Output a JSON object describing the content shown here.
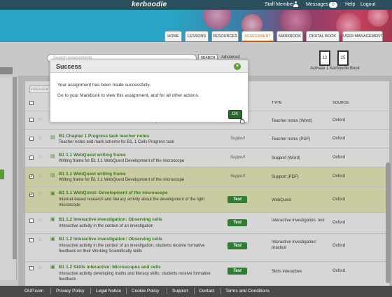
{
  "topbar": {
    "logo": "kerboodle",
    "user": "Staff Member",
    "messages_label": "Messages",
    "messages_count": "0",
    "help": "Help",
    "logout": "Logout"
  },
  "nav": {
    "tabs": [
      "HOME",
      "LESSONS",
      "RESOURCES",
      "ASSESSMENT",
      "MARKBOOK",
      "DIGITAL BOOK",
      "USER MANAGEMENT"
    ],
    "active": "ASSESSMENT"
  },
  "search": {
    "placeholder": "Search assessments",
    "button": "SEARCH",
    "advanced": "Advanced"
  },
  "activation": {
    "count_a": "12",
    "count_b": "25",
    "label": "Activate 1 Kerboodle Book"
  },
  "toolbar": {
    "preview": "PREVIEW"
  },
  "table": {
    "headers": {
      "type": "TYPE",
      "source": "SOURCE"
    },
    "rows": [
      {
        "title": "",
        "desc": "Teacher notes and mark scheme for B1, 1 Cells Progress task",
        "badge": "",
        "type": "Teacher notes (Word)",
        "source": "Oxford",
        "checked": false
      },
      {
        "title": "B1 Chapter 1 Progress task teacher notes",
        "desc": "Teacher notes and mark scheme for B1, 1 Cells Progress task",
        "badge": "Support",
        "type": "Teacher notes (PDF)",
        "source": "Oxford",
        "checked": false
      },
      {
        "title": "B1 1.1 WebQuest writing frame",
        "desc": "Writing frame for B1 1.1 WebQuest Development of the microscope",
        "badge": "Support",
        "type": "Support (Word)",
        "source": "Oxford",
        "checked": false
      },
      {
        "title": "B1 1.1 WebQuest writing frame",
        "desc": "Writing frame for B1 1.1 WebQuest Development of the microscope",
        "badge": "Support",
        "type": "Support (PDF)",
        "source": "Oxford",
        "checked": true
      },
      {
        "title": "B1 1.1 WebQuest: Development of the microscope",
        "desc": "Internet-based research and literacy activity about the development of the light microscope",
        "badge": "Test",
        "type": "WebQuest",
        "source": "Oxford",
        "checked": true
      },
      {
        "title": "B1 1.2 Interactive investigation: Observing cells",
        "desc": "Interactive activity in the context of an investigation",
        "badge": "Test",
        "type": "Interactive investigation: test",
        "source": "Oxford",
        "checked": false
      },
      {
        "title": "B1 1.2 Interactive investigation: Observing cells",
        "desc": "Interactive activity in the context of an investigation; students receive formative feedback on their Working Scientifically skills",
        "badge": "Test",
        "type": "Interactive investigation: practice",
        "source": "Oxford",
        "checked": false
      },
      {
        "title": "B1 1.2 Skills interactive: Microscopes and cells",
        "desc": "Interactive activity developing maths and literacy skills; students receive formative feedback",
        "badge": "Test",
        "type": "Skills interactive",
        "source": "Oxford",
        "checked": false
      }
    ]
  },
  "footer": {
    "links": [
      "OUP.com",
      "Privacy Policy",
      "Legal Notice",
      "Cookie Policy",
      "Support",
      "Contact",
      "Terms and Conditions"
    ]
  },
  "modal": {
    "title": "Success",
    "message1": "Your assignment has been made successfully.",
    "message2": "Go to your Markbook to view this assignment, and for all other actions.",
    "ok": "OK"
  },
  "colors": {
    "accent": "#d86b1d",
    "green": "#2e7d32",
    "header": "#2aa4c4"
  }
}
